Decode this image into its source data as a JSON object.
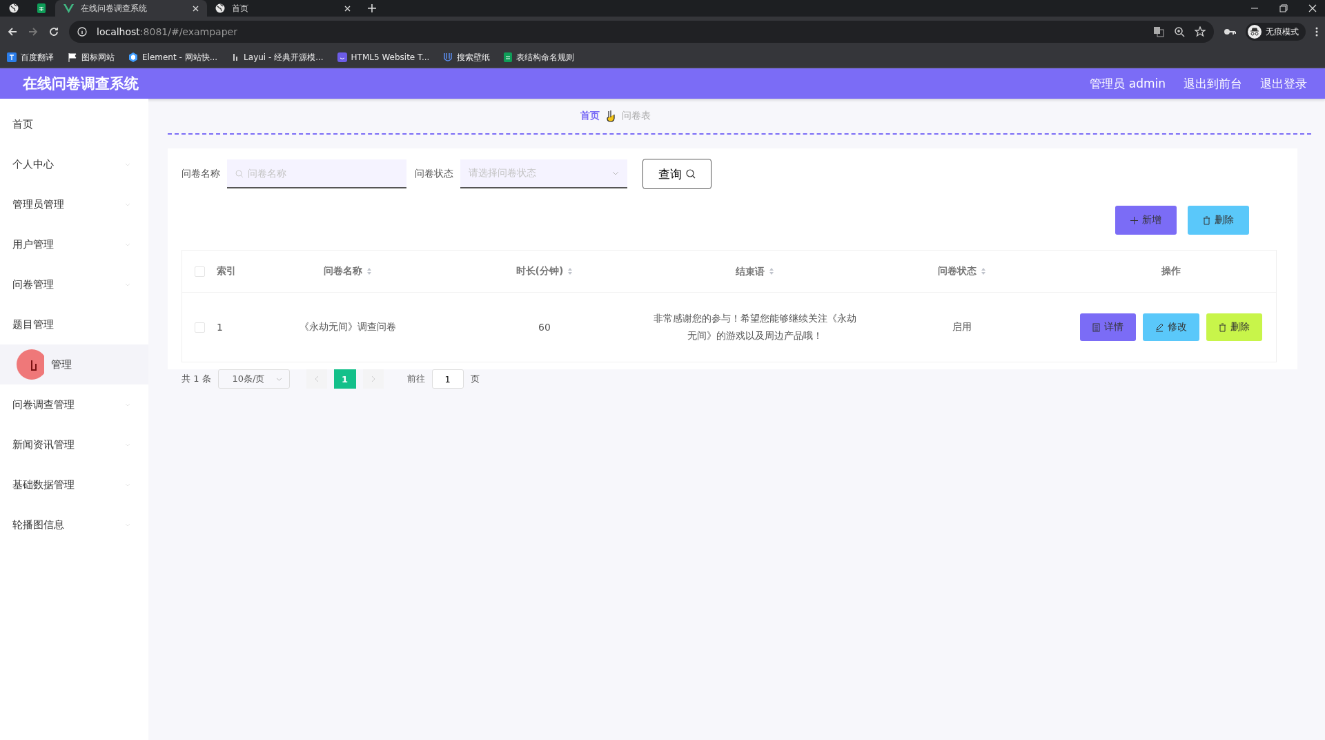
{
  "browser": {
    "tabs": [
      {
        "kind": "pinned",
        "selected": false
      },
      {
        "kind": "pinned",
        "selected": false
      },
      {
        "kind": "normal",
        "title": "在线问卷调查系统",
        "selected": true
      },
      {
        "kind": "normal",
        "title": "首页",
        "selected": false
      }
    ],
    "address": {
      "host": "localhost",
      "rest": ":8081/#/exampaper"
    },
    "bookmarks": [
      {
        "label": "百度翻译"
      },
      {
        "label": "图标网站"
      },
      {
        "label": "Element - 网站快..."
      },
      {
        "label": "Layui - 经典开源模..."
      },
      {
        "label": "HTML5 Website T..."
      },
      {
        "label": "搜索壁纸"
      },
      {
        "label": "表结构命名规则"
      }
    ],
    "profile": "无痕模式"
  },
  "header": {
    "title": "在线问卷调查系统",
    "links": [
      "管理员 admin",
      "退出到前台",
      "退出登录"
    ]
  },
  "sidebar": {
    "items": [
      {
        "label": "首页",
        "selected": false,
        "expandable": false
      },
      {
        "label": "个人中心",
        "selected": false,
        "expandable": true
      },
      {
        "label": "管理员管理",
        "selected": false,
        "expandable": true
      },
      {
        "label": "用户管理",
        "selected": false,
        "expandable": true
      },
      {
        "label": "问卷管理",
        "selected": false,
        "expandable": true
      },
      {
        "label": "题目管理",
        "selected": false,
        "expandable": false
      },
      {
        "label": "管理",
        "selected": true,
        "expandable": false
      },
      {
        "label": "问卷调查管理",
        "selected": false,
        "expandable": true
      },
      {
        "label": "新闻资讯管理",
        "selected": false,
        "expandable": true
      },
      {
        "label": "基础数据管理",
        "selected": false,
        "expandable": true
      },
      {
        "label": "轮播图信息",
        "selected": false,
        "expandable": true
      }
    ]
  },
  "breadcrumb": [
    "首页",
    "问卷表"
  ],
  "search": {
    "fields": [
      {
        "label": "问卷名称",
        "kind": "input",
        "placeholder": "问卷名称"
      },
      {
        "label": "问卷状态",
        "kind": "select",
        "placeholder": "请选择问卷状态"
      }
    ],
    "button": "查询"
  },
  "actions": [
    {
      "label": "新增",
      "kind": "add"
    },
    {
      "label": "删除",
      "kind": "delete"
    }
  ],
  "table": {
    "all_checked": false,
    "columns": [
      {
        "label": "索引",
        "sortable": false
      },
      {
        "label": "问卷名称",
        "sortable": true
      },
      {
        "label": "时长(分钟)",
        "sortable": true
      },
      {
        "label": "结束语",
        "sortable": true
      },
      {
        "label": "问卷状态",
        "sortable": true
      },
      {
        "label": "操作",
        "sortable": false
      }
    ],
    "rows": [
      {
        "checked": false,
        "cells": [
          "1",
          "《永劫无间》调查问卷",
          "60",
          "非常感谢您的参与！希望您能够继续关注《永劫无间》的游戏以及周边产品哦！",
          "启用"
        ],
        "actions": [
          {
            "label": "详情",
            "kind": "detail"
          },
          {
            "label": "修改",
            "kind": "edit"
          },
          {
            "label": "删除",
            "kind": "delete"
          }
        ]
      }
    ]
  },
  "pagination": {
    "total": "共 1 条",
    "page_size": "10条/页",
    "pages": [
      {
        "label": "1",
        "selected": true
      }
    ],
    "goto_label": "前往",
    "goto_value": "1",
    "suffix": "页"
  }
}
